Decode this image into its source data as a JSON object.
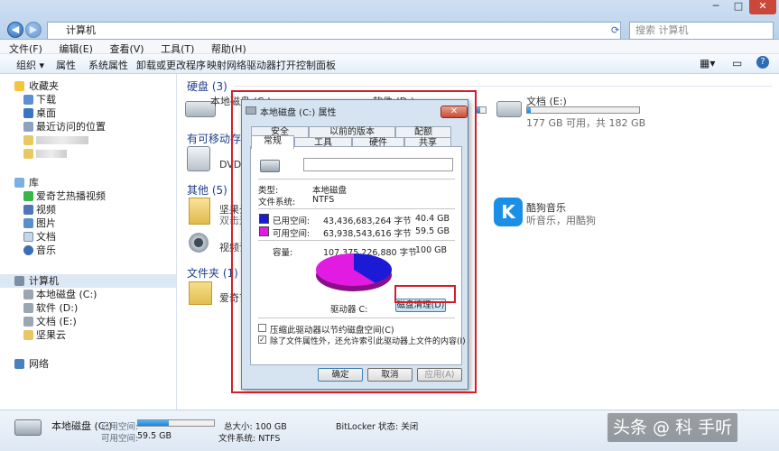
{
  "window": {
    "address": "计算机",
    "search_placeholder": "搜索 计算机",
    "controls": [
      "─",
      "□",
      "✕"
    ]
  },
  "menu": [
    "文件(F)",
    "编辑(E)",
    "查看(V)",
    "工具(T)",
    "帮助(H)"
  ],
  "toolbar": [
    "组织 ▾",
    "属性",
    "系统属性",
    "卸载或更改程序",
    "映射网络驱动器",
    "打开控制面板"
  ],
  "sidebar": {
    "favorites_label": "收藏夹",
    "favorites": [
      "下载",
      "桌面",
      "最近访问的位置"
    ],
    "library_label": "库",
    "libraries": [
      "爱奇艺热播视频",
      "视频",
      "图片",
      "文档",
      "音乐"
    ],
    "computer_label": "计算机",
    "drives": [
      "本地磁盘 (C:)",
      "软件 (D:)",
      "文档 (E:)",
      "坚果云"
    ],
    "network_label": "网络"
  },
  "content": {
    "hard_disks": "硬盘 (3)",
    "removable": "有可移动存储",
    "others": "其他 (5)",
    "folders": "文件夹 (1)",
    "drive_c_name": "本地磁盘 (C:)",
    "drive_d_name": "软件 (D:)",
    "drive_e_name": "文档 (E:)",
    "drive_e_free": "177 GB 可用，共 182 GB",
    "drive_e_fill": 0.03,
    "dvd": "DVD 驱",
    "jianguo": "坚果云",
    "jianguo_sub": "双击运",
    "video_dev": "视频设",
    "iqiyi": "爱奇艺",
    "kugou_name": "酷狗音乐",
    "kugou_sub": "听音乐，用酷狗"
  },
  "dialog": {
    "title": "本地磁盘 (C:) 属性",
    "close": "✕",
    "tabs_row1": [
      "安全",
      "以前的版本",
      "配额"
    ],
    "tabs_row2": [
      "常规",
      "工具",
      "硬件",
      "共享"
    ],
    "type_label": "类型:",
    "type_value": "本地磁盘",
    "fs_label": "文件系统:",
    "fs_value": "NTFS",
    "used_label": "已用空间:",
    "used_bytes": "43,436,683,264 字节",
    "used_gb": "40.4 GB",
    "free_label": "可用空间:",
    "free_bytes": "63,938,543,616 字节",
    "free_gb": "59.5 GB",
    "cap_label": "容量:",
    "cap_bytes": "107,375,226,880 字节",
    "cap_gb": "100 GB",
    "drive_label": "驱动器 C:",
    "cleanup": "磁盘清理(D)",
    "compress": "压缩此驱动器以节约磁盘空间(C)",
    "index": "除了文件属性外，还允许索引此驱动器上文件的内容(I)",
    "ok": "确定",
    "cancel": "取消",
    "apply": "应用(A)",
    "used_color": "#1b1bd6",
    "free_color": "#e21be2",
    "used_fraction": 0.404
  },
  "status": {
    "drive": "本地磁盘 (C:)",
    "used_label": "已用空间:",
    "free_label": "可用空间:",
    "free_value": "59.5 GB",
    "total": "总大小: 100 GB",
    "fs": "文件系统: NTFS",
    "bitlocker": "BitLocker 状态: 关闭",
    "used_fraction": 0.404
  },
  "watermark": "头条 @ 科 手听"
}
